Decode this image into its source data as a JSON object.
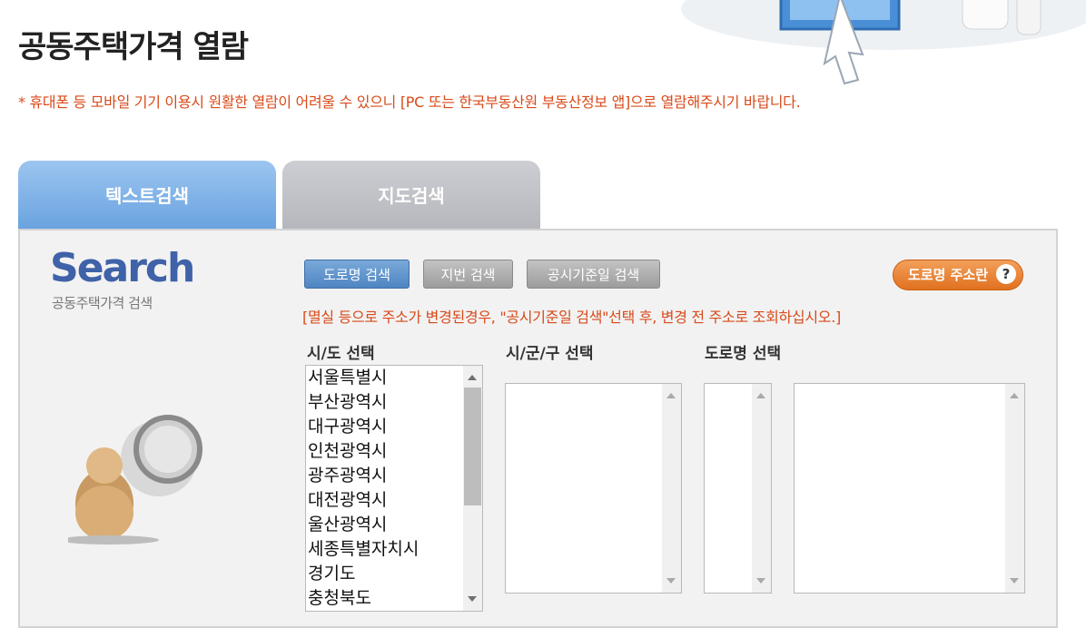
{
  "page": {
    "title": "공동주택가격 열람",
    "notice": "* 휴대폰 등 모바일 기기 이용시 원활한 열람이 어려울 수 있으니 [PC 또는 한국부동산원 부동산정보 앱]으로 열람해주시기 바랍니다."
  },
  "tabs": [
    {
      "label": "텍스트검색",
      "active": true
    },
    {
      "label": "지도검색",
      "active": false
    }
  ],
  "logo": {
    "title": "Search",
    "subtitle": "공동주택가격 검색"
  },
  "search_buttons": {
    "road": "도로명 검색",
    "lot": "지번 검색",
    "date": "공시기준일 검색"
  },
  "road_address_help": {
    "label": "도로명 주소란",
    "icon": "?"
  },
  "warning": "[멸실 등으로 주소가 변경된경우, \"공시기준일 검색\"선택 후, 변경 전 주소로 조회하십시오.]",
  "columns": {
    "sido": "시/도 선택",
    "sigungu": "시/군/구 선택",
    "road": "도로명 선택"
  },
  "sido_options": [
    "서울특별시",
    "부산광역시",
    "대구광역시",
    "인천광역시",
    "광주광역시",
    "대전광역시",
    "울산광역시",
    "세종특별자치시",
    "경기도",
    "충청북도"
  ],
  "colors": {
    "accent_blue": "#4f85c2",
    "notice_red": "#d84a1a",
    "orange": "#e0711f"
  }
}
